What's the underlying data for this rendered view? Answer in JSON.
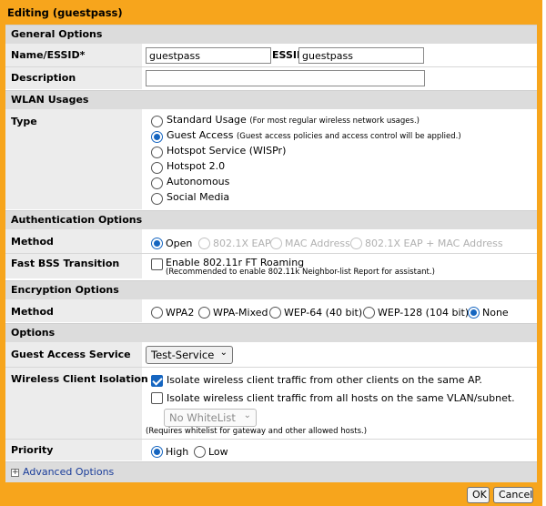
{
  "title": "Editing (guestpass)",
  "sections": {
    "general": "General Options",
    "wlan_usages": "WLAN Usages",
    "auth": "Authentication Options",
    "encryption": "Encryption Options",
    "options": "Options"
  },
  "general": {
    "name_label": "Name/ESSID*",
    "name_value": "guestpass",
    "essid_label": "ESSID",
    "essid_value": "guestpass",
    "description_label": "Description",
    "description_value": ""
  },
  "type": {
    "label": "Type",
    "options": [
      {
        "label": "Standard Usage",
        "note": "(For most regular wireless network usages.)",
        "selected": false
      },
      {
        "label": "Guest Access",
        "note": "(Guest access policies and access control will be applied.)",
        "selected": true
      },
      {
        "label": "Hotspot Service (WISPr)",
        "note": "",
        "selected": false
      },
      {
        "label": "Hotspot 2.0",
        "note": "",
        "selected": false
      },
      {
        "label": "Autonomous",
        "note": "",
        "selected": false
      },
      {
        "label": "Social Media",
        "note": "",
        "selected": false
      }
    ]
  },
  "auth": {
    "method_label": "Method",
    "methods": [
      {
        "label": "Open",
        "selected": true,
        "disabled": false
      },
      {
        "label": "802.1X EAP",
        "selected": false,
        "disabled": true
      },
      {
        "label": "MAC Address",
        "selected": false,
        "disabled": true
      },
      {
        "label": "802.1X EAP + MAC Address",
        "selected": false,
        "disabled": true
      }
    ],
    "fbt_label": "Fast BSS Transition",
    "fbt_option": "Enable 802.11r FT Roaming",
    "fbt_note": "(Recommended to enable 802.11k Neighbor-list Report for assistant.)",
    "fbt_checked": false
  },
  "encryption": {
    "method_label": "Method",
    "methods": [
      {
        "label": "WPA2",
        "selected": false
      },
      {
        "label": "WPA-Mixed",
        "selected": false
      },
      {
        "label": "WEP-64 (40 bit)",
        "selected": false
      },
      {
        "label": "WEP-128 (104 bit)",
        "selected": false
      },
      {
        "label": "None",
        "selected": true
      }
    ]
  },
  "options": {
    "guest_service_label": "Guest Access Service",
    "guest_service_value": "Test-Service",
    "isolation_label": "Wireless Client Isolation",
    "isolation_ap": "Isolate wireless client traffic from other clients on the same AP.",
    "isolation_ap_checked": true,
    "isolation_vlan": "Isolate wireless client traffic from all hosts on the same VLAN/subnet.",
    "isolation_vlan_checked": false,
    "whitelist_value": "No WhiteList",
    "whitelist_note": "(Requires whitelist for gateway and other allowed hosts.)",
    "priority_label": "Priority",
    "priority_high": "High",
    "priority_low": "Low",
    "priority_selected": "High"
  },
  "advanced": "Advanced Options",
  "buttons": {
    "ok": "OK",
    "cancel": "Cancel"
  },
  "colors": {
    "frame": "#f7a51c",
    "section": "#dcdcdc",
    "accent": "#1565c0",
    "link": "#1a3d9a"
  }
}
